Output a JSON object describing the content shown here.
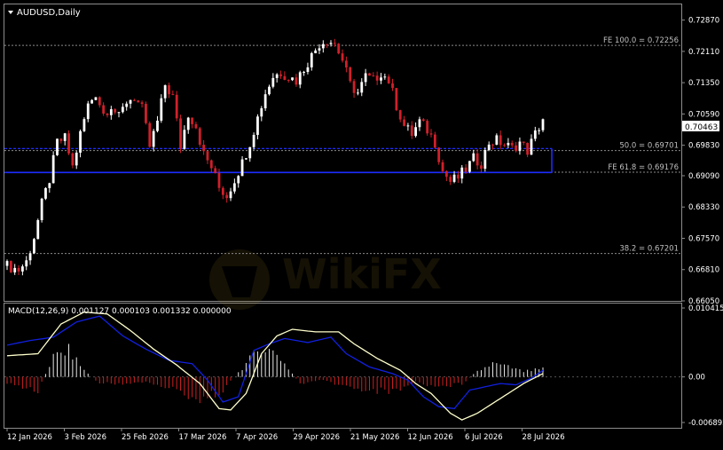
{
  "symbol_label": "AUDUSD,Daily",
  "current_price_label": "0.70463",
  "colors": {
    "background": "#000000",
    "bull_candle": "#ffffff",
    "bear_candle": "#d0202a",
    "zone_border": "#1c2cff",
    "fibo_line": "#8a8a8a",
    "macd_signal": "#ffffcc",
    "macd_line": "#1020e0",
    "hist_positive": "#e8e8e8",
    "hist_negative": "#d02020"
  },
  "price_axis": {
    "ticks": [
      "0.72870",
      "0.72110",
      "0.71350",
      "0.70590",
      "0.69830",
      "0.69090",
      "0.68330",
      "0.67570",
      "0.66810",
      "0.66050"
    ]
  },
  "macd_panel": {
    "label": "MACD(12,26,9) 0.001127 0.000103 0.001332 0.000000",
    "ticks": [
      "0.010415",
      "0.00",
      "-0.006892"
    ]
  },
  "time_axis": {
    "labels": [
      "12 Jan 2026",
      "3 Feb 2026",
      "25 Feb 2026",
      "17 Mar 2026",
      "7 Apr 2026",
      "29 Apr 2026",
      "21 May 2026",
      "12 Jun 2026",
      "6 Jul 2026",
      "28 Jul 2026"
    ]
  },
  "fibo_levels": [
    {
      "label": "FE 100.0 = 0.72256",
      "price": 0.72256
    },
    {
      "label": "50.0 = 0.69701",
      "price": 0.69701
    },
    {
      "label": "FE 61.8 = 0.69176",
      "price": 0.69176
    },
    {
      "label": "38.2 = 0.67201",
      "price": 0.67201
    }
  ],
  "zone": {
    "top_price": 0.6975,
    "bottom_price": 0.6917
  },
  "chart_data": {
    "type": "candlestick",
    "symbol": "AUDUSD",
    "timeframe": "Daily",
    "last_price": 0.70463,
    "price_range": [
      0.6605,
      0.7325
    ],
    "dates": [
      "12 Jan 2026",
      "3 Feb 2026",
      "25 Feb 2026",
      "17 Mar 2026",
      "7 Apr 2026",
      "29 Apr 2026",
      "21 May 2026",
      "12 Jun 2026",
      "6 Jul 2026",
      "28 Jul 2026"
    ],
    "close_path": [
      [
        0,
        0.669
      ],
      [
        3,
        0.668
      ],
      [
        5,
        0.67
      ],
      [
        7,
        0.676
      ],
      [
        9,
        0.684
      ],
      [
        11,
        0.69
      ],
      [
        13,
        0.699
      ],
      [
        15,
        0.7
      ],
      [
        17,
        0.693
      ],
      [
        19,
        0.701
      ],
      [
        21,
        0.708
      ],
      [
        23,
        0.711
      ],
      [
        25,
        0.706
      ],
      [
        27,
        0.708
      ],
      [
        29,
        0.705
      ],
      [
        31,
        0.709
      ],
      [
        33,
        0.71
      ],
      [
        35,
        0.707
      ],
      [
        37,
        0.698
      ],
      [
        39,
        0.704
      ],
      [
        41,
        0.713
      ],
      [
        43,
        0.71
      ],
      [
        45,
        0.698
      ],
      [
        47,
        0.706
      ],
      [
        49,
        0.703
      ],
      [
        51,
        0.696
      ],
      [
        53,
        0.693
      ],
      [
        55,
        0.688
      ],
      [
        57,
        0.686
      ],
      [
        59,
        0.69
      ],
      [
        61,
        0.694
      ],
      [
        63,
        0.699
      ],
      [
        65,
        0.705
      ],
      [
        67,
        0.711
      ],
      [
        69,
        0.715
      ],
      [
        71,
        0.716
      ],
      [
        73,
        0.715
      ],
      [
        75,
        0.714
      ],
      [
        77,
        0.717
      ],
      [
        79,
        0.72
      ],
      [
        81,
        0.723
      ],
      [
        83,
        0.724
      ],
      [
        85,
        0.723
      ],
      [
        87,
        0.719
      ],
      [
        89,
        0.713
      ],
      [
        91,
        0.711
      ],
      [
        93,
        0.715
      ],
      [
        95,
        0.714
      ],
      [
        97,
        0.716
      ],
      [
        99,
        0.714
      ],
      [
        101,
        0.708
      ],
      [
        103,
        0.703
      ],
      [
        105,
        0.701
      ],
      [
        107,
        0.704
      ],
      [
        109,
        0.702
      ],
      [
        111,
        0.699
      ],
      [
        113,
        0.692
      ],
      [
        115,
        0.6895
      ],
      [
        117,
        0.6905
      ],
      [
        119,
        0.6925
      ],
      [
        121,
        0.695
      ],
      [
        123,
        0.694
      ],
      [
        125,
        0.699
      ],
      [
        127,
        0.6995
      ],
      [
        129,
        0.6985
      ],
      [
        131,
        0.6975
      ],
      [
        133,
        0.699
      ],
      [
        135,
        0.697
      ],
      [
        137,
        0.701
      ],
      [
        139,
        0.7046
      ]
    ],
    "macd_range": [
      -0.006892,
      0.010415
    ],
    "macd_signal_path": [
      [
        0,
        0.0032
      ],
      [
        8,
        0.0035
      ],
      [
        14,
        0.008
      ],
      [
        20,
        0.0098
      ],
      [
        26,
        0.0095
      ],
      [
        32,
        0.007
      ],
      [
        38,
        0.0042
      ],
      [
        44,
        0.0018
      ],
      [
        50,
        -0.001
      ],
      [
        55,
        -0.0048
      ],
      [
        58,
        -0.005
      ],
      [
        62,
        -0.0025
      ],
      [
        66,
        0.0035
      ],
      [
        70,
        0.0062
      ],
      [
        74,
        0.0072
      ],
      [
        80,
        0.0068
      ],
      [
        86,
        0.0068
      ],
      [
        90,
        0.005
      ],
      [
        96,
        0.0028
      ],
      [
        102,
        0.001
      ],
      [
        106,
        -0.001
      ],
      [
        110,
        -0.0025
      ],
      [
        115,
        -0.0055
      ],
      [
        118,
        -0.0065
      ],
      [
        122,
        -0.0055
      ],
      [
        126,
        -0.004
      ],
      [
        130,
        -0.0025
      ],
      [
        134,
        -0.001
      ],
      [
        139,
        0.0005
      ]
    ],
    "macd_line_path": [
      [
        0,
        0.0048
      ],
      [
        6,
        0.0055
      ],
      [
        12,
        0.006
      ],
      [
        18,
        0.0083
      ],
      [
        24,
        0.0092
      ],
      [
        30,
        0.0062
      ],
      [
        36,
        0.0042
      ],
      [
        42,
        0.0025
      ],
      [
        48,
        0.002
      ],
      [
        52,
        -0.0005
      ],
      [
        56,
        -0.0038
      ],
      [
        60,
        -0.003
      ],
      [
        64,
        0.004
      ],
      [
        68,
        0.005
      ],
      [
        72,
        0.0058
      ],
      [
        78,
        0.0052
      ],
      [
        84,
        0.006
      ],
      [
        88,
        0.0035
      ],
      [
        94,
        0.0015
      ],
      [
        100,
        0.0005
      ],
      [
        104,
        -0.0005
      ],
      [
        108,
        -0.003
      ],
      [
        112,
        -0.0045
      ],
      [
        116,
        -0.0048
      ],
      [
        120,
        -0.002
      ],
      [
        124,
        -0.0015
      ],
      [
        128,
        -0.001
      ],
      [
        132,
        -0.0012
      ],
      [
        136,
        -0.0002
      ],
      [
        139,
        0.001
      ]
    ],
    "histogram_path": [
      [
        0,
        -0.001
      ],
      [
        8,
        -0.002
      ],
      [
        12,
        0.003
      ],
      [
        16,
        0.004
      ],
      [
        20,
        0.001
      ],
      [
        24,
        -0.001
      ],
      [
        30,
        -0.001
      ],
      [
        36,
        -0.0008
      ],
      [
        44,
        -0.002
      ],
      [
        50,
        -0.0035
      ],
      [
        56,
        -0.002
      ],
      [
        62,
        0.002
      ],
      [
        66,
        0.0045
      ],
      [
        70,
        0.0035
      ],
      [
        76,
        -0.001
      ],
      [
        82,
        -0.0005
      ],
      [
        88,
        -0.0015
      ],
      [
        94,
        -0.002
      ],
      [
        100,
        -0.0022
      ],
      [
        106,
        -0.0008
      ],
      [
        112,
        -0.0015
      ],
      [
        118,
        -0.001
      ],
      [
        122,
        0.0008
      ],
      [
        126,
        0.002
      ],
      [
        130,
        0.0015
      ],
      [
        134,
        0.0008
      ],
      [
        139,
        0.0012
      ]
    ]
  }
}
